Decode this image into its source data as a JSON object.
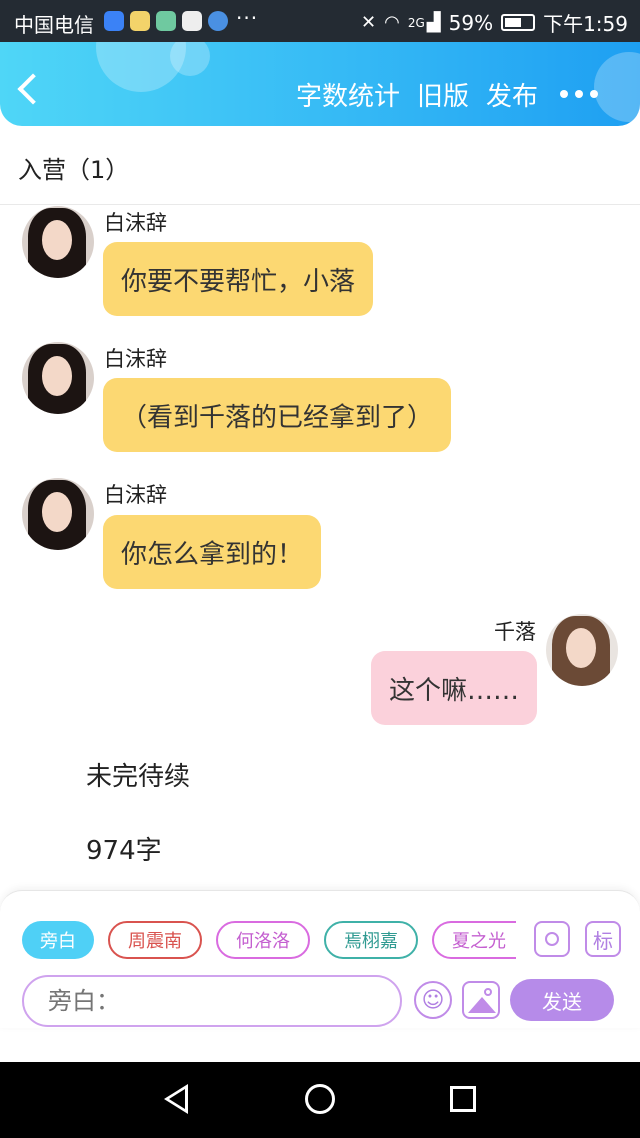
{
  "status_bar": {
    "carrier": "中国电信",
    "dots": "···",
    "signal_type": "2G",
    "battery": "59%",
    "time": "下午1:59"
  },
  "header": {
    "word_count": "字数统计",
    "old_version": "旧版",
    "publish": "发布"
  },
  "camp_title": "入营（1）",
  "messages": [
    {
      "sender": "白沫辞",
      "text": "你要不要帮忙，小落"
    },
    {
      "sender": "白沫辞",
      "text": "（看到千落的已经拿到了）"
    },
    {
      "sender": "白沫辞",
      "text": "你怎么拿到的！"
    },
    {
      "sender": "千落",
      "text": "这个嘛……"
    }
  ],
  "trailing": {
    "to_be_continued": "未完待续",
    "word_total": "974字"
  },
  "composer": {
    "chips": [
      "旁白",
      "周震南",
      "何洛洛",
      "焉栩嘉",
      "夏之光"
    ],
    "tag_label": "标",
    "input_placeholder": "旁白：",
    "send_label": "发送"
  },
  "colors": {
    "header_start": "#4fd6f7",
    "header_end": "#1e9ff2",
    "bubble_left": "#fcd872",
    "bubble_right": "#fbd1db",
    "accent_purple": "#b68be9"
  }
}
